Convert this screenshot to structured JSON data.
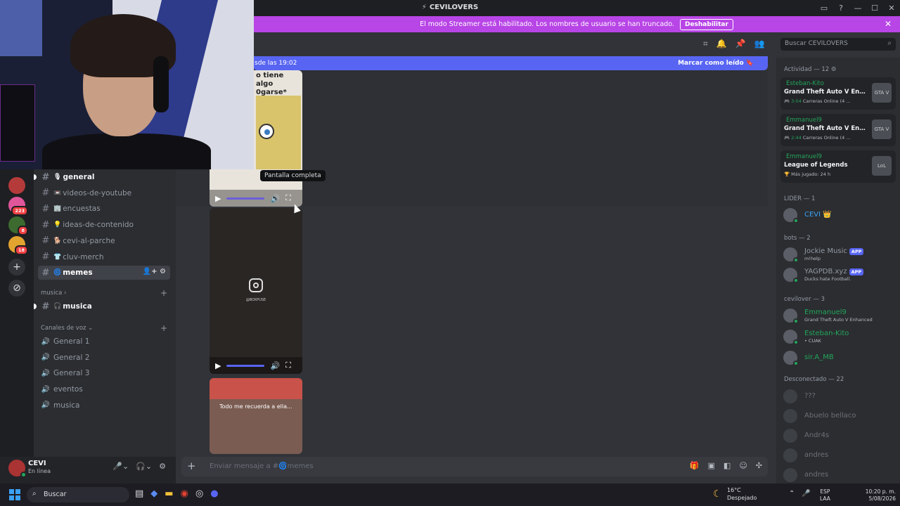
{
  "window": {
    "title": "CEVILOVERS"
  },
  "banner": {
    "text": "El modo Streamer está habilitado. Los nombres de usuario se han truncado.",
    "button": "Deshabilitar"
  },
  "servers": [
    {
      "name": "server-1",
      "color": "#b53b3b",
      "badge": ""
    },
    {
      "name": "server-2",
      "color": "#e0569b",
      "badge": "223"
    },
    {
      "name": "server-3",
      "color": "#3d6b2f",
      "badge": "8"
    },
    {
      "name": "server-4",
      "color": "#e3a32f",
      "badge": "18"
    }
  ],
  "channels": [
    {
      "emoji": "🎙",
      "name": "general",
      "style": "bold"
    },
    {
      "emoji": "📼",
      "name": "videos-de-youtube",
      "style": ""
    },
    {
      "emoji": "🏢",
      "name": "encuestas",
      "style": ""
    },
    {
      "emoji": "💡",
      "name": "ideas-de-contenido",
      "style": ""
    },
    {
      "emoji": "🐕",
      "name": "cevi-al-parche",
      "style": ""
    },
    {
      "emoji": "👕",
      "name": "cluv-merch",
      "style": ""
    },
    {
      "emoji": "🌀",
      "name": "memes",
      "style": "active"
    }
  ],
  "categories": {
    "musica": "musica",
    "voice": "Canales de voz"
  },
  "musica_channel": {
    "emoji": "🎧",
    "name": "musica"
  },
  "voice_channels": [
    "General 1",
    "General 2",
    "General 3",
    "eventos",
    "musica"
  ],
  "user": {
    "name": "CEVI",
    "status": "En línea"
  },
  "search": {
    "placeholder": "Buscar CEVILOVERS"
  },
  "newbar": {
    "left": "sde las 19:02",
    "right": "Marcar como leído"
  },
  "meme": {
    "text_line1": "o tiene algo",
    "text_line2": "0garse*"
  },
  "tooltip": "Pantalla completa",
  "media3": {
    "caption": "Todo me recuerda a ella..."
  },
  "instagram": {
    "handle": "@BOXPUSE"
  },
  "composer": {
    "placeholder": "Enviar mensaje a #🌀memes"
  },
  "members": {
    "activity_header": "Actividad — 12",
    "activities": [
      {
        "user": "Esteban-Kito",
        "game": "Grand Theft Auto V Enhan...",
        "timer": "3:04",
        "detail": "Carreras Online (4 ...",
        "icon": "GTA V"
      },
      {
        "user": "Emmanuel9",
        "game": "Grand Theft Auto V Enhan...",
        "timer": "2:44",
        "detail": "Carreras Online (4 ...",
        "icon": "GTA V"
      },
      {
        "user": "Emmanuel9",
        "game": "League of Legends",
        "timer": "",
        "detail": "Más jugado: 24 h",
        "icon": "LoL"
      }
    ],
    "lider_header": "LIDER — 1",
    "lider": [
      {
        "name": "CEVI 👑",
        "color": "#3ba1f5"
      }
    ],
    "bots_header": "bots — 2",
    "bots": [
      {
        "name": "Jockie Music",
        "tag": "APP",
        "sub": "m!help"
      },
      {
        "name": "YAGPDB.xyz",
        "tag": "APP",
        "sub": "Ducks hate Football."
      }
    ],
    "cevilover_header": "cevilover — 3",
    "cevilovers": [
      {
        "name": "Emmanuel9",
        "sub": "Grand Theft Auto V Enhanced"
      },
      {
        "name": "Esteban-Kito",
        "sub": "• CUAK"
      },
      {
        "name": "sir.A_MB",
        "sub": ""
      }
    ],
    "offline_header": "Desconectado — 22",
    "offline": [
      "???",
      "Abuelo bellaco",
      "Andr4s",
      "andres",
      "andres"
    ]
  },
  "taskbar": {
    "search": "Buscar",
    "weather_temp": "16°C",
    "weather_cond": "Despejado",
    "lang1": "ESP",
    "lang2": "LAA",
    "time": "10:20 p. m.",
    "date": "5/08/2026"
  }
}
